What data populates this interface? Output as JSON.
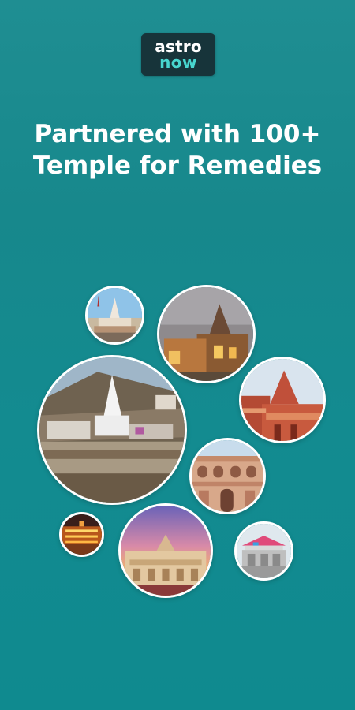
{
  "logo": {
    "line1": "astro",
    "line2": "now"
  },
  "headline": {
    "line1": "Partnered with 100+",
    "line2": "Temple for Remedies"
  },
  "temples": [
    {
      "icon": "temple-photo-1"
    },
    {
      "icon": "temple-photo-2"
    },
    {
      "icon": "temple-photo-3"
    },
    {
      "icon": "temple-photo-4"
    },
    {
      "icon": "temple-photo-5"
    },
    {
      "icon": "temple-photo-6"
    },
    {
      "icon": "temple-photo-7"
    },
    {
      "icon": "temple-photo-8"
    }
  ]
}
